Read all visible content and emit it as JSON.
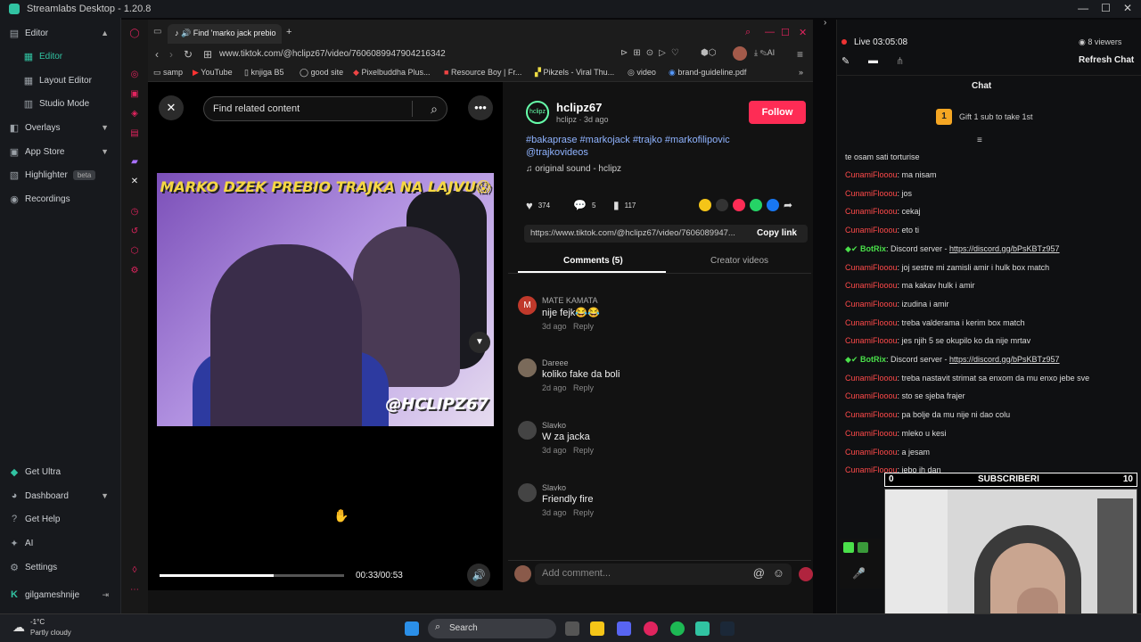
{
  "app": {
    "title": "Streamlabs Desktop - 1.20.8"
  },
  "sidebar": {
    "items": [
      {
        "label": "Editor",
        "icon": "layout-icon"
      },
      {
        "label": "Editor",
        "icon": "grid-icon"
      },
      {
        "label": "Layout Editor",
        "icon": "grid-icon"
      },
      {
        "label": "Studio Mode",
        "icon": "studio-icon"
      },
      {
        "label": "Overlays",
        "icon": "overlay-icon"
      },
      {
        "label": "App Store",
        "icon": "store-icon"
      },
      {
        "label": "Highlighter",
        "icon": "highlighter-icon",
        "badge": "beta"
      },
      {
        "label": "Recordings",
        "icon": "record-icon"
      }
    ],
    "bottom": [
      {
        "label": "Get Ultra"
      },
      {
        "label": "Dashboard"
      },
      {
        "label": "Get Help"
      },
      {
        "label": "AI"
      },
      {
        "label": "Settings"
      }
    ],
    "user": "gilgameshnije"
  },
  "browser": {
    "tab_title": "Find 'marko jack prebio",
    "url": "www.tiktok.com/@hclipz67/video/7606089947904216342",
    "bookmarks": [
      "samp",
      "YouTube",
      "knjiga B5",
      "good site",
      "Pixelbuddha Plus...",
      "Resource Boy | Fr...",
      "Pikzels - Viral Thu...",
      "video",
      "brand-guideline.pdf"
    ]
  },
  "tiktok": {
    "search_placeholder": "Find related content",
    "video_title": "MARKO DZEK PREBIO TRAJKA NA LAJVU😱",
    "video_handle": "@HCLIPZ67",
    "time": "00:33/00:53",
    "progress": 0.62,
    "author": "hclipz67",
    "author_meta": "hclipz · 3d ago",
    "follow_label": "Follow",
    "hashtags": "#bakaprase #markojack #trajko #markofilipovic @trajkovideos",
    "sound": "original sound - hclipz",
    "likes": "374",
    "comments_count": "5",
    "saves": "117",
    "link": "https://www.tiktok.com/@hclipz67/video/7606089947...",
    "copy_label": "Copy link",
    "tab_comments": "Comments (5)",
    "tab_creator": "Creator videos",
    "comments": [
      {
        "name": "MATE KAMATA",
        "text": "nije fejk😂😂",
        "meta": "3d ago",
        "reply": "Reply",
        "avatar": "M"
      },
      {
        "name": "Dareee",
        "text": "koliko fake da boli",
        "meta": "2d ago",
        "reply": "Reply",
        "avatar": ""
      },
      {
        "name": "Slavko",
        "text": "W za jacka",
        "meta": "3d ago",
        "reply": "Reply",
        "avatar": ""
      },
      {
        "name": "Slavko",
        "text": "Friendly fire",
        "meta": "3d ago",
        "reply": "Reply",
        "avatar": ""
      }
    ],
    "add_comment_placeholder": "Add comment..."
  },
  "chat": {
    "live_label": "Live",
    "live_time": "03:05:08",
    "viewers": "8 viewers",
    "refresh_label": "Refresh Chat",
    "header": "Chat",
    "gift_text": "Gift 1 sub to take 1st",
    "gift_count": "1",
    "truncated_top": "te osam sati torturise",
    "messages": [
      {
        "user": "CunamiFlooou",
        "text": ": ma nisam"
      },
      {
        "user": "CunamiFlooou",
        "text": ": jos"
      },
      {
        "user": "CunamiFlooou",
        "text": ": cekaj"
      },
      {
        "user": "CunamiFlooou",
        "text": ": eto ti"
      },
      {
        "user": "BotRix",
        "text": ": Discord server - ",
        "link": "https://discord.gg/bPsKBTz957",
        "bot": true
      },
      {
        "user": "CunamiFlooou",
        "text": ": joj sestre mi zamisli amir i hulk box match"
      },
      {
        "user": "CunamiFlooou",
        "text": ": ma kakav hulk i amir"
      },
      {
        "user": "CunamiFlooou",
        "text": ": izudina i amir"
      },
      {
        "user": "CunamiFlooou",
        "text": ": treba valderama i kerim box match"
      },
      {
        "user": "CunamiFlooou",
        "text": ": jes njih 5 se okupilo ko da nije mrtav"
      },
      {
        "user": "BotRix",
        "text": ": Discord server - ",
        "link": "https://discord.gg/bPsKBTz957",
        "bot": true
      },
      {
        "user": "CunamiFlooou",
        "text": ": treba nastavit strimat sa enxom da mu enxo jebe sve"
      },
      {
        "user": "CunamiFlooou",
        "text": ": sto se sjeba frajer"
      },
      {
        "user": "CunamiFlooou",
        "text": ": pa bolje da mu nije ni dao colu"
      },
      {
        "user": "CunamiFlooou",
        "text": ": mleko u kesi"
      },
      {
        "user": "CunamiFlooou",
        "text": ": a jesam"
      },
      {
        "user": "CunamiFlooou",
        "text": ": jebo ih dan"
      }
    ],
    "subs_label": "SUBSCRIBERI",
    "subs_left": "0",
    "subs_right": "10"
  },
  "taskbar": {
    "weather_temp": "-1°C",
    "weather_desc": "Partly cloudy",
    "search_label": "Search"
  },
  "colors": {
    "accent": "#31c3a2",
    "tiktok_red": "#fe2c55",
    "chat_user": "#ff4a4a",
    "bot": "#4ae04a"
  }
}
